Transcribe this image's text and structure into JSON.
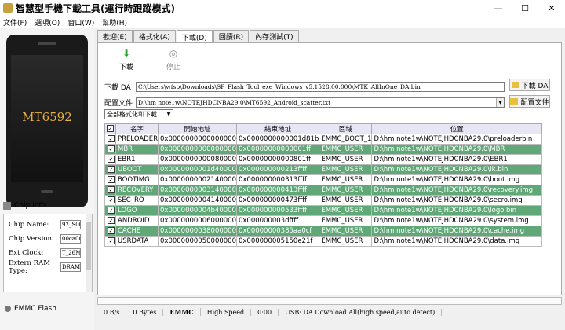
{
  "title": "智慧型手機下載工具(運行時跟蹤模式)",
  "window_buttons": [
    "—",
    "☐",
    "✕"
  ],
  "menu": [
    "文件(F)",
    "選項(O)",
    "窗口(W)",
    "幫助(H)"
  ],
  "device": {
    "chip_label": "MT6592"
  },
  "chip_info": {
    "header": "Chip Info",
    "rows": [
      {
        "label": "Chip Name:",
        "value": "92_S00"
      },
      {
        "label": "Chip Version:",
        "value": "00ca00"
      },
      {
        "label": "Ext Clock:",
        "value": "T_26M"
      },
      {
        "label": "Extern RAM Type:",
        "value": "DRAM"
      }
    ]
  },
  "emmc_label": "EMMC Flash",
  "tabs": [
    "歡迎(E)",
    "格式化(A)",
    "下載(D)",
    "回讀(R)",
    "內存測試(T)"
  ],
  "active_tab": 2,
  "toolbar": {
    "download": "下載",
    "stop": "停止"
  },
  "form": {
    "da_label": "下載 DA",
    "da_path": "C:\\Users\\wfsp\\Downloads\\SP_Flash_Tool_exe_Windows_v5.1528.00.000\\MTK_AllInOne_DA.bin",
    "da_button": "下載 DA",
    "scatter_label": "配置文件",
    "scatter_path": "D:\\hm note1w\\NOTEJHDCNBA29.0\\MT6592_Android_scatter.txt",
    "scatter_button": "配置文件",
    "mode_selected": "全部格式化和下載"
  },
  "table": {
    "headers": [
      "",
      "名字",
      "開始地址",
      "結束地址",
      "區域",
      "位置"
    ],
    "rows": [
      {
        "checked": true,
        "highlight": false,
        "name": "PRELOADER",
        "start": "0x0000000000000000",
        "end": "0x0000000000001d81b",
        "region": "EMMC_BOOT_1",
        "location": "D:\\hm note1w\\NOTEJHDCNBA29.0\\preloaderbin"
      },
      {
        "checked": true,
        "highlight": true,
        "name": "MBR",
        "start": "0x0000000000000000",
        "end": "0x00000000000001ff",
        "region": "EMMC_USER",
        "location": "D:\\hm note1w\\NOTEJHDCNBA29.0\\MBR"
      },
      {
        "checked": true,
        "highlight": false,
        "name": "EBR1",
        "start": "0x0000000000080000",
        "end": "0x00000000000801ff",
        "region": "EMMC_USER",
        "location": "D:\\hm note1w\\NOTEJHDCNBA29.0\\EBR1"
      },
      {
        "checked": true,
        "highlight": true,
        "name": "UBOOT",
        "start": "0x0000000001d40000",
        "end": "0x000000000213ffff",
        "region": "EMMC_USER",
        "location": "D:\\hm note1w\\NOTEJHDCNBA29.0\\lk.bin"
      },
      {
        "checked": true,
        "highlight": false,
        "name": "BOOTIMG",
        "start": "0x0000000002140000",
        "end": "0x000000000313ffff",
        "region": "EMMC_USER",
        "location": "D:\\hm note1w\\NOTEJHDCNBA29.0\\boot.img"
      },
      {
        "checked": true,
        "highlight": true,
        "name": "RECOVERY",
        "start": "0x0000000003140000",
        "end": "0x000000000413ffff",
        "region": "EMMC_USER",
        "location": "D:\\hm note1w\\NOTEJHDCNBA29.0\\recovery.img"
      },
      {
        "checked": true,
        "highlight": false,
        "name": "SEC_RO",
        "start": "0x0000000004140000",
        "end": "0x000000000473ffff",
        "region": "EMMC_USER",
        "location": "D:\\hm note1w\\NOTEJHDCNBA29.0\\secro.img"
      },
      {
        "checked": true,
        "highlight": true,
        "name": "LOGO",
        "start": "0x0000000004b40000",
        "end": "0x000000000533ffff",
        "region": "EMMC_USER",
        "location": "D:\\hm note1w\\NOTEJHDCNBA29.0\\logo.bin"
      },
      {
        "checked": true,
        "highlight": false,
        "name": "ANDROID",
        "start": "0x0000000006000000",
        "end": "0x000000003dffff",
        "region": "EMMC_USER",
        "location": "D:\\hm note1w\\NOTEJHDCNBA29.0\\system.img"
      },
      {
        "checked": true,
        "highlight": true,
        "name": "CACHE",
        "start": "0x0000000038000000",
        "end": "0x00000000385aa0cf",
        "region": "EMMC_USER",
        "location": "D:\\hm note1w\\NOTEJHDCNBA29.0\\cache.img"
      },
      {
        "checked": true,
        "highlight": false,
        "name": "USRDATA",
        "start": "0x0000000050000000",
        "end": "0x000000005150e21f",
        "region": "EMMC_USER",
        "location": "D:\\hm note1w\\NOTEJHDCNBA29.0\\data.img"
      }
    ]
  },
  "progress": 0,
  "status": [
    "0 B/s",
    "0 Bytes",
    "EMMC",
    "High Speed",
    "0:00",
    "USB: DA Download All(high speed,auto detect)"
  ],
  "colors": {
    "highlight_row": "#60a878",
    "chip_text": "#e8b040"
  }
}
